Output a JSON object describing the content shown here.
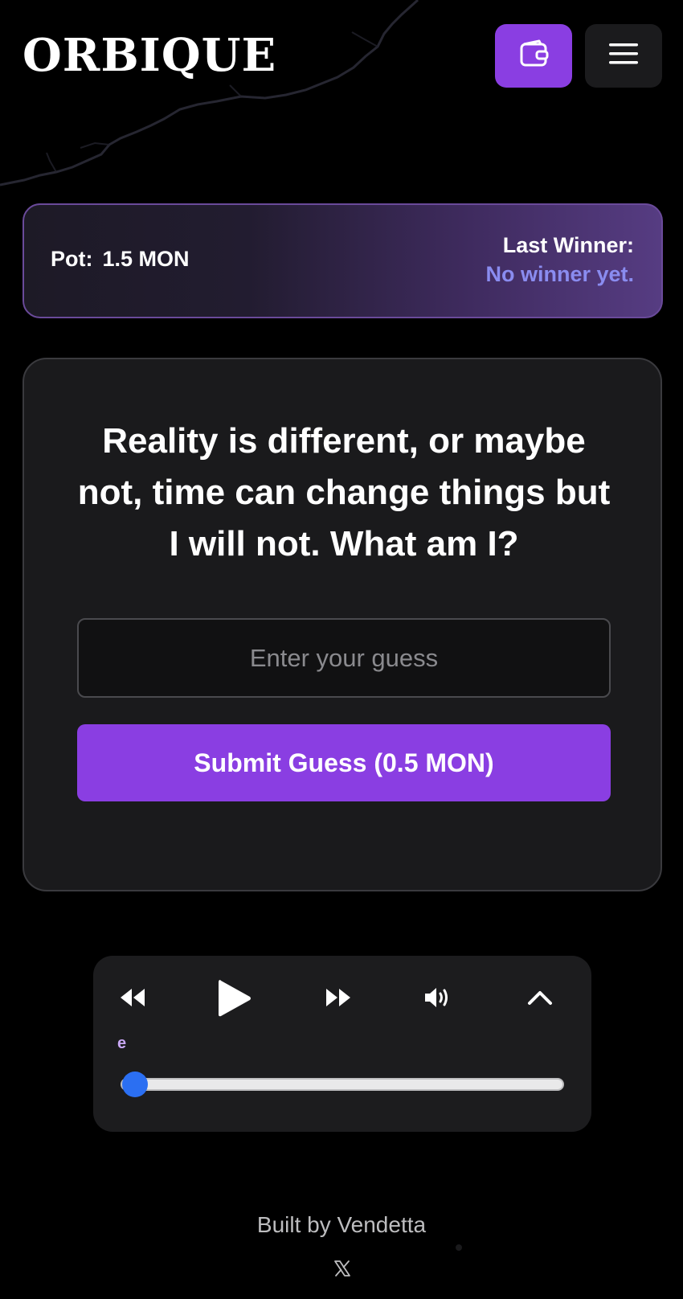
{
  "header": {
    "logo": "ORBIQUE",
    "wallet_icon": "wallet-icon",
    "menu_icon": "hamburger-menu-icon"
  },
  "pot": {
    "label": "Pot:",
    "value": "1.5 MON",
    "last_winner_label": "Last Winner:",
    "last_winner_value": "No winner yet."
  },
  "riddle": {
    "question": "Reality is different, or maybe not, time can change things but I will not. What am I?",
    "input_placeholder": "Enter your guess",
    "input_value": "",
    "submit_label": "Submit Guess (0.5 MON)"
  },
  "player": {
    "track_name": "e",
    "progress": 0.03,
    "icons": [
      "rewind-icon",
      "play-icon",
      "fast-forward-icon",
      "volume-icon",
      "chevron-up-icon"
    ]
  },
  "footer": {
    "credit": "Built by Vendetta",
    "social_icon": "x-logo-icon"
  },
  "colors": {
    "accent": "#8a3ee2",
    "winner_text": "#8a8cf0",
    "track_text": "#c9a8f5",
    "slider_thumb": "#2b6ff2",
    "card_bg": "#1a1a1c",
    "page_bg": "#000000"
  }
}
